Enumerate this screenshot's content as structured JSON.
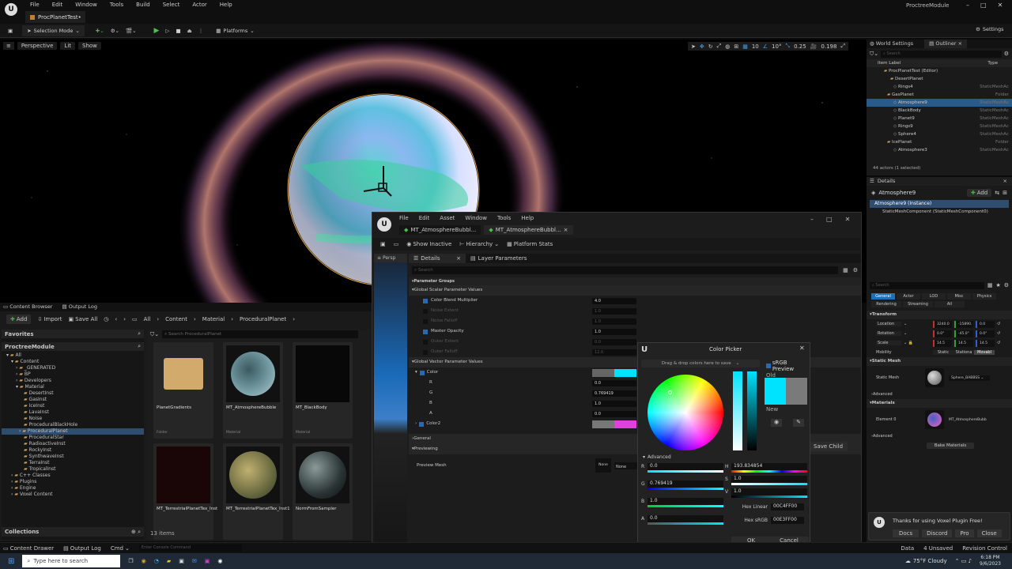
{
  "app": {
    "tab_title": "ProcPlanetTest•",
    "project_name": "ProctreeModule",
    "menu": [
      "File",
      "Edit",
      "Window",
      "Tools",
      "Build",
      "Select",
      "Actor",
      "Help"
    ]
  },
  "toolbar": {
    "selection_mode": "Selection Mode",
    "platforms": "Platforms",
    "settings": "Settings",
    "grid_snap": "10",
    "rot_snap": "10°",
    "scale_snap": "0.25",
    "cam_speed": "0.198"
  },
  "viewport": {
    "perspective": "Perspective",
    "lit": "Lit",
    "show": "Show"
  },
  "content_browser": {
    "tabs": [
      "Content Browser",
      "Output Log"
    ],
    "add": "Add",
    "import": "Import",
    "save_all": "Save All",
    "path": [
      "All",
      "Content",
      "Material",
      "ProceduralPlanet"
    ],
    "favorites": "Favorites",
    "module": "ProctreeModule",
    "search_placeholder": "Search ProceduralPlanet",
    "tree": [
      "All",
      "Content",
      "_GENERATED",
      "BP",
      "Developers",
      "Material",
      "DesertInst",
      "GasInst",
      "IceInst",
      "LavaInst",
      "Noise",
      "ProceduralBlackHole",
      "ProceduralPlanet",
      "ProceduralStar",
      "RadioactiveInst",
      "RockyInst",
      "SynthwaveInst",
      "TerraInst",
      "TropicalInst",
      "C++ Classes",
      "Plugins",
      "Engine",
      "Voxel Content"
    ],
    "assets": [
      {
        "name": "PlanetGradients",
        "type": "Folder"
      },
      {
        "name": "MT_AtmosphereBubble",
        "type": "Material"
      },
      {
        "name": "MT_BlackBody",
        "type": "Material"
      },
      {
        "name": "MT_TerrestrialPlanetTex_Inst",
        "type": ""
      },
      {
        "name": "MT_TerrestrialPlanetTex_Inst1",
        "type": ""
      },
      {
        "name": "NormFromSampler",
        "type": ""
      }
    ],
    "count": "13 items",
    "collections": "Collections"
  },
  "bottom": {
    "content_drawer": "Content Drawer",
    "output_log": "Output Log",
    "cmd": "Cmd",
    "console_placeholder": "Enter Console Command",
    "derived_data": "Data",
    "unsaved": "4 Unsaved",
    "revision": "Revision Control"
  },
  "material_editor": {
    "menu": [
      "File",
      "Edit",
      "Asset",
      "Window",
      "Tools",
      "Help"
    ],
    "tabs": [
      "MT_AtmosphereBubbl...",
      "MT_AtmosphereBubbl..."
    ],
    "toolbar": [
      "Show Inactive",
      "Hierarchy",
      "Platform Stats"
    ],
    "panel_tabs": [
      "Details",
      "Layer Parameters"
    ],
    "viewport_tab": "Persp",
    "search_placeholder": "Search",
    "groups": "Parameter Groups",
    "scalar_header": "Global Scalar Parameter Values",
    "scalars": [
      {
        "name": "Color Blend Multiplier",
        "value": "4.0",
        "enabled": true
      },
      {
        "name": "Noise Extent",
        "value": "1.0",
        "enabled": false
      },
      {
        "name": "Noise Falloff",
        "value": "1.0",
        "enabled": false
      },
      {
        "name": "Master Opacity",
        "value": "1.0",
        "enabled": true
      },
      {
        "name": "Outer Extent",
        "value": "0.0",
        "enabled": false
      },
      {
        "name": "Outer Falloff",
        "value": "12.0",
        "enabled": false
      }
    ],
    "vector_header": "Global Vector Parameter Values",
    "color_name": "Color",
    "rgba": [
      {
        "k": "R",
        "v": "0.0"
      },
      {
        "k": "G",
        "v": "0.769419"
      },
      {
        "k": "B",
        "v": "1.0"
      },
      {
        "k": "A",
        "v": "0.0"
      }
    ],
    "color2_name": "Color2",
    "general": "General",
    "previewing": "Previewing",
    "preview_mesh": "Preview Mesh",
    "none": "None",
    "save_child": "Save Child"
  },
  "color_picker": {
    "title": "Color Picker",
    "drag_hint": "Drag & drop colors here to save",
    "srgb": "sRGB Preview",
    "old": "Old",
    "new": "New",
    "advanced": "Advanced",
    "r": "0.0",
    "g": "0.769419",
    "b": "1.0",
    "a": "0.0",
    "h": "193.834854",
    "s": "1.0",
    "v": "1.0",
    "hex_linear_label": "Hex Linear",
    "hex_linear": "00C4FF00",
    "hex_srgb_label": "Hex sRGB",
    "hex_srgb": "00E3FF00",
    "ok": "OK",
    "cancel": "Cancel",
    "current_color": "#00e3ff"
  },
  "outliner": {
    "tabs": [
      "World Settings",
      "Outliner"
    ],
    "search_placeholder": "Search",
    "col_label": "Item Label",
    "col_type": "Type",
    "rows": [
      {
        "label": "ProcPlanetTest (Editor)",
        "type": ""
      },
      {
        "label": "DesertPlanet",
        "type": ""
      },
      {
        "label": "Rings4",
        "type": "StaticMeshAc"
      },
      {
        "label": "GasPlanet",
        "type": "Folder"
      },
      {
        "label": "Atmosphere9",
        "type": "StaticMeshAc"
      },
      {
        "label": "BlackBody",
        "type": "StaticMeshAc"
      },
      {
        "label": "Planet9",
        "type": "StaticMeshAc"
      },
      {
        "label": "Rings9",
        "type": "StaticMeshAc"
      },
      {
        "label": "Sphere4",
        "type": "StaticMeshAc"
      },
      {
        "label": "IcePlanet",
        "type": "Folder"
      },
      {
        "label": "Atmosphere3",
        "type": "StaticMeshAc"
      }
    ],
    "count": "44 actors (1 selected)"
  },
  "details": {
    "tab": "Details",
    "actor": "Atmosphere9",
    "add": "Add",
    "instance": "Atmosphere9 (Instance)",
    "component": "StaticMeshComponent (StaticMeshComponent0)",
    "search_placeholder": "Search",
    "filters1": [
      "General",
      "Actor",
      "LOD",
      "Misc",
      "Physics"
    ],
    "filters2": [
      "Rendering",
      "Streaming",
      "All"
    ],
    "transform": "Transform",
    "location": {
      "label": "Location",
      "x": "3240.0",
      "y": "-15890.",
      "z": "0.0"
    },
    "rotation": {
      "label": "Rotation",
      "x": "0.0°",
      "y": "-45.0°",
      "z": "0.0°"
    },
    "scale": {
      "label": "Scale",
      "x": "14.5",
      "y": "14.5",
      "z": "14.5"
    },
    "mobility": "Mobility",
    "mob_opts": [
      "Static",
      "Stationa",
      "Movabl"
    ],
    "static_mesh_hdr": "Static Mesh",
    "static_mesh_label": "Static Mesh",
    "mesh_name": "Sphere_BABBSS",
    "advanced": "Advanced",
    "materials": "Materials",
    "element0": "Element 0",
    "mat_name": "MT_AtmosphereBubb",
    "bake": "Bake Materials"
  },
  "voxel_notice": {
    "title": "Thanks for using Voxel Plugin Free!",
    "buttons": [
      "Docs",
      "Discord",
      "Pro",
      "Close"
    ]
  },
  "taskbar": {
    "search": "Type here to search",
    "weather": "75°F Cloudy",
    "time": "6:18 PM",
    "date": "9/6/2023"
  }
}
